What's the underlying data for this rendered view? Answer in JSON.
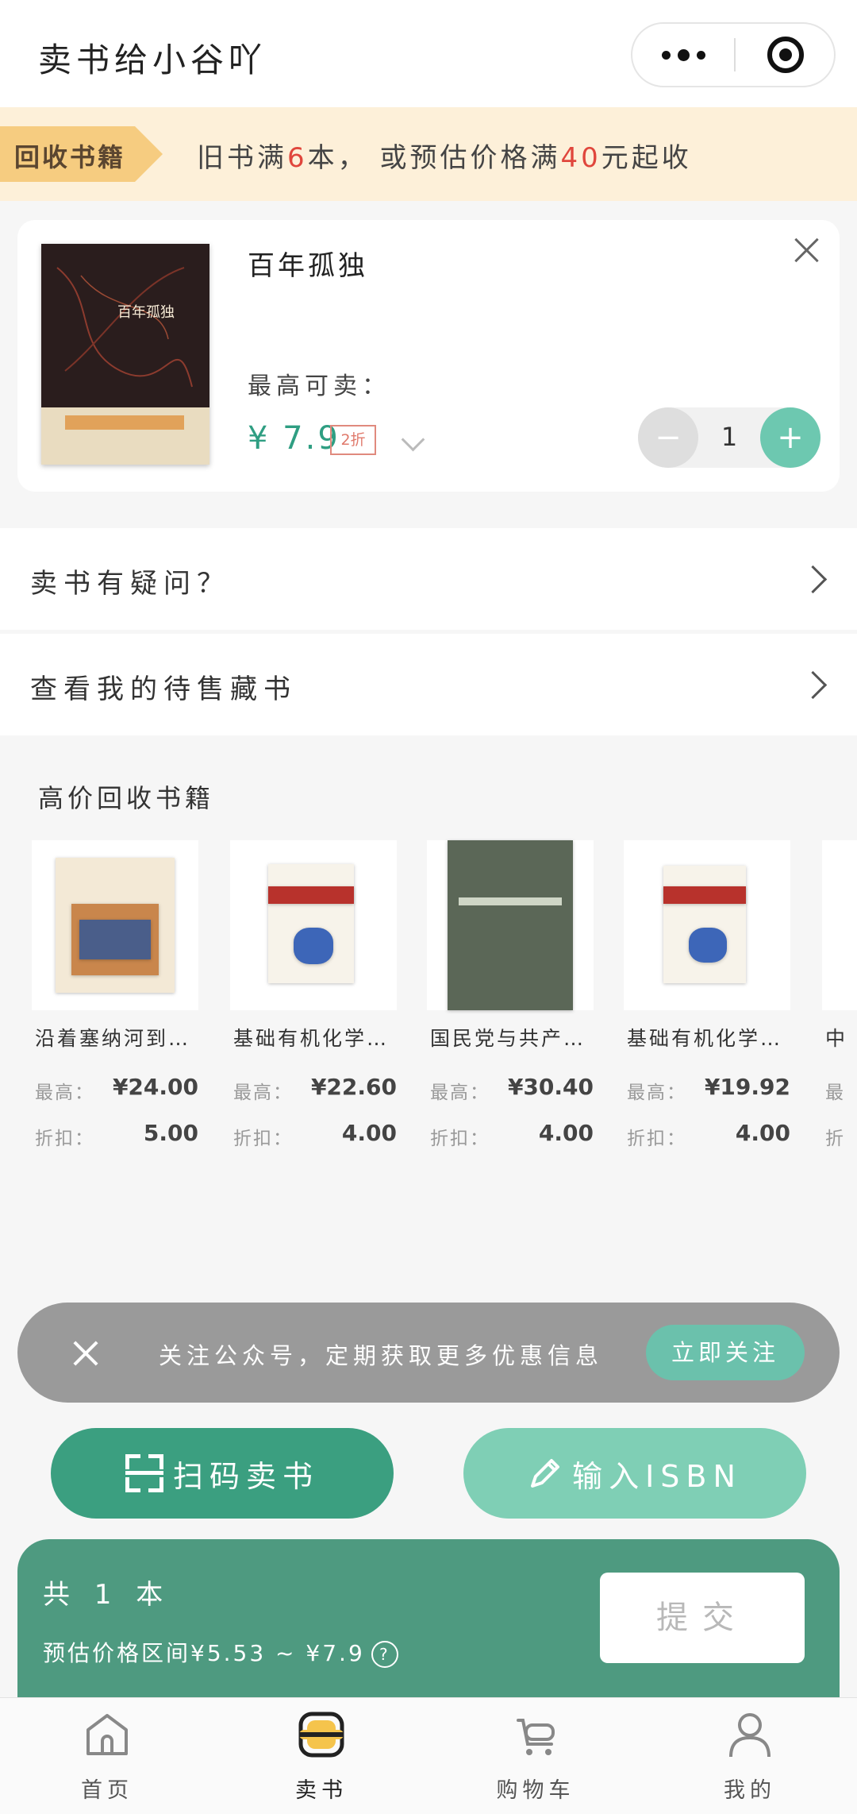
{
  "header": {
    "title": "卖书给小谷吖"
  },
  "notice": {
    "tag": "回收书籍",
    "text_a": "旧书满",
    "text_b": "6",
    "text_c": "本，  或预估价格满",
    "text_d": "40",
    "text_e": "元起收"
  },
  "book": {
    "name": "百年孤独",
    "max_label": "最高可卖：",
    "price": "¥ 7.9",
    "discount": "2折",
    "quantity": "1",
    "cover_title": "百年孤独"
  },
  "rows": [
    {
      "label": "卖书有疑问？"
    },
    {
      "label": "查看我的待售藏书"
    }
  ],
  "recommend": {
    "title": "高价回收书籍",
    "max_key": "最高：",
    "discount_key": "折扣：",
    "items": [
      {
        "title": "沿着塞纳河到…",
        "max": "¥24.00",
        "discount": "5.00"
      },
      {
        "title": "基础有机化学…",
        "max": "¥22.60",
        "discount": "4.00"
      },
      {
        "title": "国民党与共产…",
        "max": "¥30.40",
        "discount": "4.00"
      },
      {
        "title": "基础有机化学…",
        "max": "¥19.92",
        "discount": "4.00"
      },
      {
        "title": "中",
        "max": "",
        "discount": ""
      }
    ],
    "partial_key_max": "最",
    "partial_key_discount": "折"
  },
  "follow": {
    "text": "关注公众号，定期获取更多优惠信息",
    "button": "立即关注"
  },
  "actions": {
    "scan": "扫码卖书",
    "isbn": "输入ISBN"
  },
  "summary": {
    "count": "共 1 本",
    "range": "预估价格区间¥5.53 ~ ¥7.9",
    "help": "?",
    "submit": "提交"
  },
  "tabs": [
    {
      "label": "首页",
      "icon": "home-icon"
    },
    {
      "label": "卖书",
      "icon": "sell-book-icon"
    },
    {
      "label": "购物车",
      "icon": "cart-icon"
    },
    {
      "label": "我的",
      "icon": "profile-icon"
    }
  ],
  "colors": {
    "accent": "#3b9f80",
    "accent_light": "#7fcfb5",
    "notice_bg": "#fdf0d9",
    "notice_tag": "#f6cc80",
    "highlight_red": "#e0463c"
  }
}
